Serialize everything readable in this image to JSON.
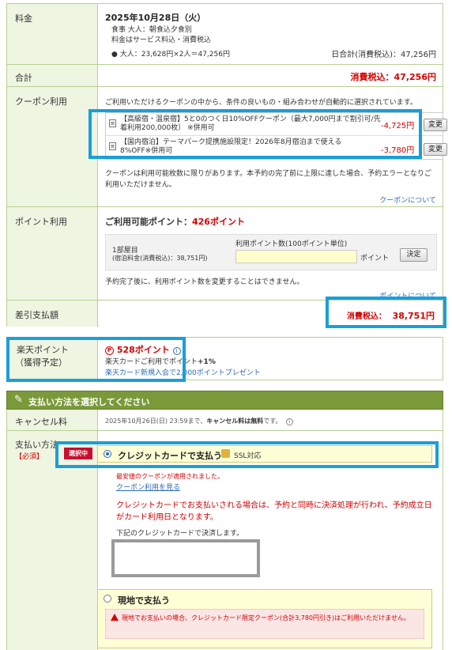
{
  "fee": {
    "label": "料金",
    "date": "2025年10月28日（火）",
    "meal": "食事  大人：朝食込夕食別",
    "tax_note": "料金はサービス料込・消費税込",
    "breakdown": "大人：23,628円×2人＝47,256円",
    "daily_total": "日合計(消費税込)：47,256円"
  },
  "total": {
    "label": "合計",
    "value": "消費税込：47,256円"
  },
  "coupon": {
    "label": "クーポン利用",
    "intro": "ご利用いただけるクーポンの中から、条件の良いもの・組み合わせが自動的に選択されています。",
    "items": [
      {
        "text": "【高級宿・温泉宿】5と0のつく日10%OFFクーポン（最大7,000円まで割引可/先着利用200,000枚） ※併用可",
        "amount": "-4,725円",
        "button": "変更"
      },
      {
        "text": "【国内宿泊】テーマパーク提携施設限定！2026年8月宿泊まで使える8%OFF※併用可",
        "amount": "-3,780円",
        "button": "変更"
      }
    ],
    "note": "クーポンは利用可能枚数に限りがあります。本予約の完了前に上限に達した場合、予約エラーとなりご利用いただけません。",
    "about_link": "クーポンについて"
  },
  "points": {
    "label": "ポイント利用",
    "available_label": "ご利用可能ポイント：",
    "available_value": "426ポイント",
    "room_label": "1部屋目",
    "room_price": "(宿泊料金(消費税込)：38,751円)",
    "input_label": "利用ポイント数(100ポイント単位)",
    "input_value": "",
    "unit": "ポイント",
    "decide_button": "決定",
    "note": "予約完了後に、利用ポイント数を変更することはできません。",
    "about_link": "ポイントについて"
  },
  "balance": {
    "label": "差引支払額",
    "tax_label": "消費税込：",
    "value": "38,751円"
  },
  "rakuten_points": {
    "label_line1": "楽天ポイント",
    "label_line2": "（獲得予定）",
    "icon_text": "P",
    "points": "528ポイント",
    "card_text": "楽天カードご利用でポイント",
    "card_bonus": "+1%",
    "new_member_link": "楽天カード新規入会で2,000ポイントプレゼント"
  },
  "payment": {
    "header": "支払い方法を選択してください",
    "cancel_label": "キャンセル料",
    "cancel_text_pre": "2025年10月26日(日) 23:59まで、",
    "cancel_text_bold": "キャンセル料は無料",
    "cancel_text_post": "です。",
    "method_label": "支払い方法",
    "required": "【必須】",
    "selected_badge": "選択中",
    "credit_label": "クレジットカードで支払う",
    "ssl_label": "SSL対応",
    "coupon_applied": "最安値のクーポンが適用されました。",
    "coupon_usage_link": "クーポン利用を見る",
    "credit_note": "クレジットカードでお支払いされる場合は、予約と同時に決済処理が行われ、予約成立日がカード利用日となります。",
    "card_instruction": "下記のクレジットカードで決済します。",
    "onsite_label": "現地で支払う",
    "onsite_warning": "現地でお支払いの場合、クレジットカード限定クーポン(合計3,780円引き)はご利用いただけません。"
  },
  "colors": {
    "accent_blue": "#1a9fd8",
    "header_green": "#7a9a3a",
    "price_red": "#d40000"
  }
}
